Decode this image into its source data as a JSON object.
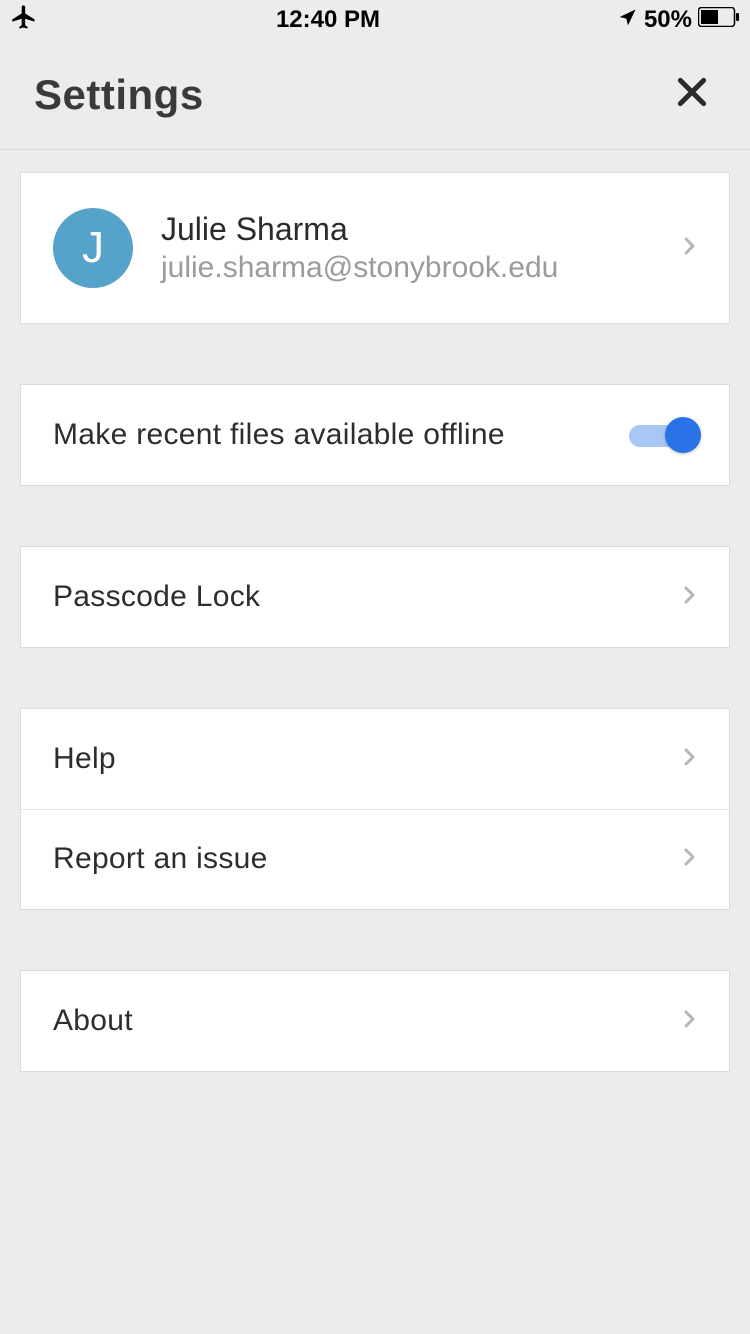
{
  "status": {
    "time": "12:40 PM",
    "battery_pct": "50%"
  },
  "header": {
    "title": "Settings"
  },
  "account": {
    "initial": "J",
    "name": "Julie Sharma",
    "email": "julie.sharma@stonybrook.edu"
  },
  "offline": {
    "label": "Make recent files available offline",
    "enabled": true
  },
  "rows": {
    "passcode": "Passcode Lock",
    "help": "Help",
    "report": "Report an issue",
    "about": "About"
  }
}
